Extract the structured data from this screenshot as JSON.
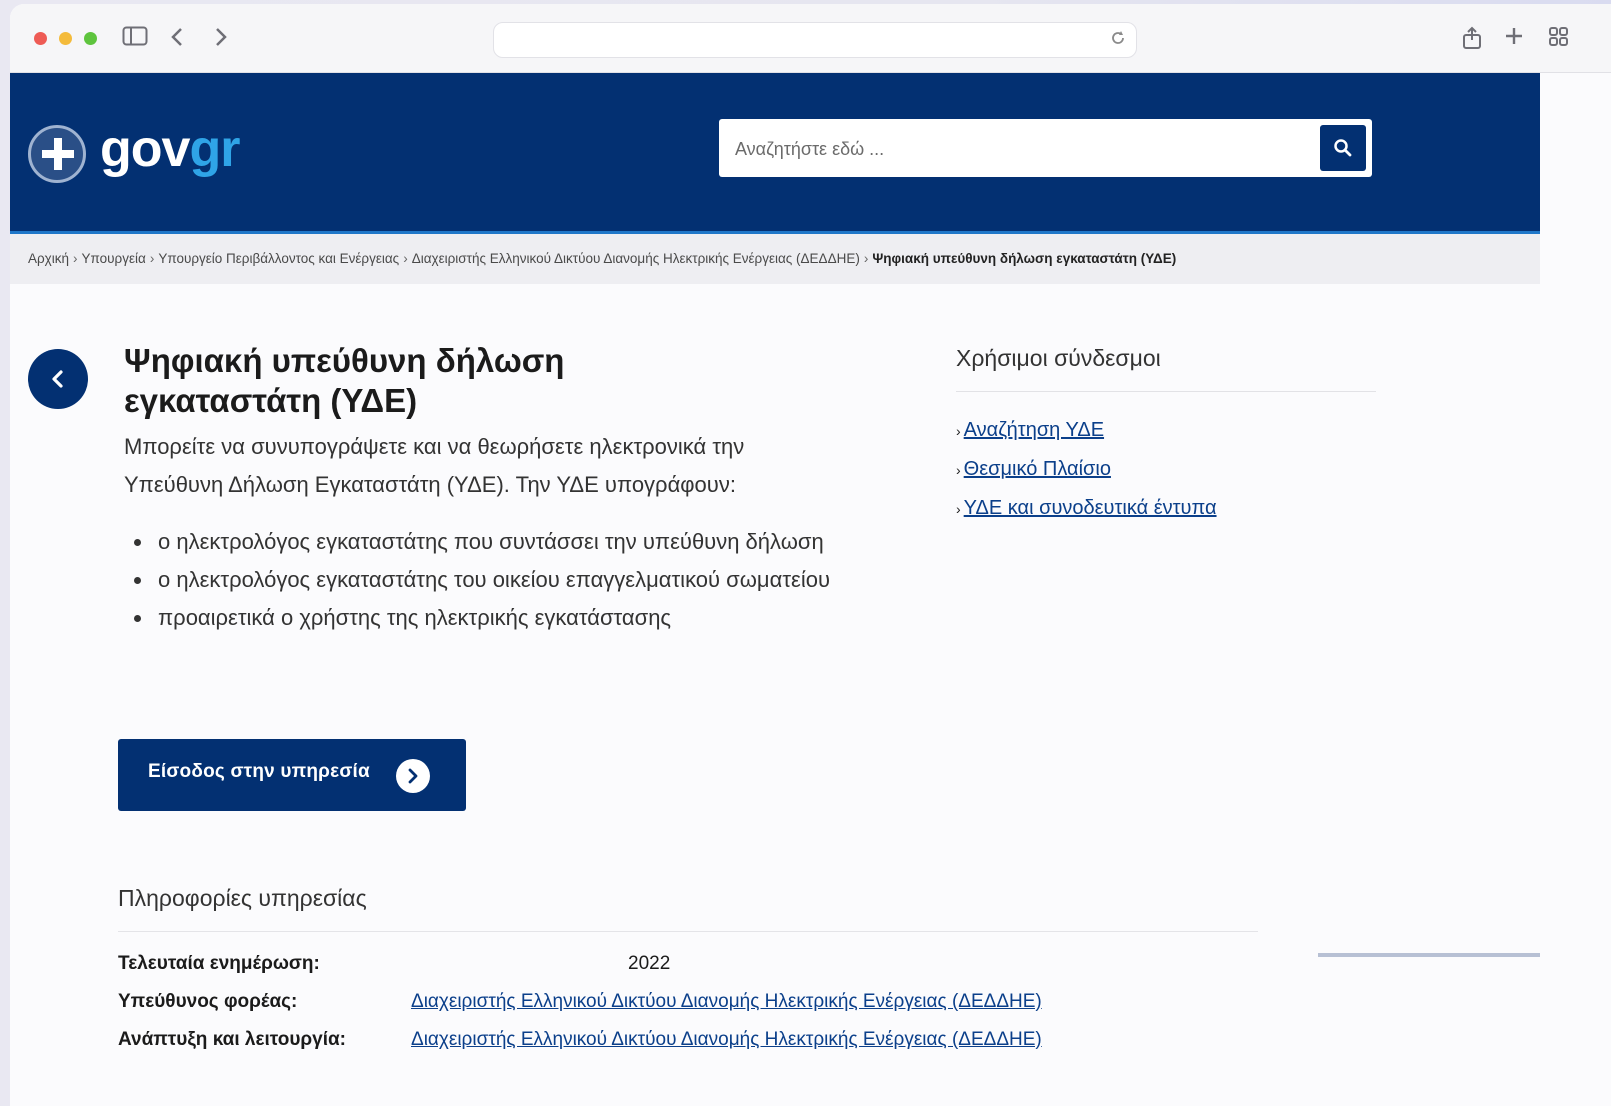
{
  "browser": {
    "url": ""
  },
  "header": {
    "logo_gov": "gov",
    "logo_gr": "gr",
    "search_placeholder": "Αναζητήστε εδώ ..."
  },
  "breadcrumb": [
    "Αρχική",
    "Υπουργεία",
    "Υπουργείο Περιβάλλοντος και Ενέργειας",
    "Διαχειριστής Ελληνικού Δικτύου Διανομής Ηλεκτρικής Ενέργειας (ΔΕΔΔΗΕ)",
    "Ψηφιακή υπεύθυνη δήλωση εγκαταστάτη (ΥΔΕ)"
  ],
  "main": {
    "title": "Ψηφιακή υπεύθυνη δήλωση εγκαταστάτη (ΥΔΕ)",
    "intro": "Μπορείτε να συνυπογράψετε και να θεωρήσετε ηλεκτρονικά την Υπεύθυνη Δήλωση Εγκαταστάτη (ΥΔΕ). Την ΥΔΕ υπογράφουν:",
    "bullets": [
      "ο ηλεκτρολόγος εγκαταστάτης που συντάσσει την υπεύθυνη δήλωση",
      "ο ηλεκτρολόγος εγκαταστάτης του οικείου επαγγελματικού σωματείου",
      "προαιρετικά ο χρήστης της ηλεκτρικής εγκατάστασης"
    ],
    "service_button": "Είσοδος στην υπηρεσία"
  },
  "useful_links": {
    "title": "Χρήσιμοι σύνδεσμοι",
    "items": [
      "Αναζήτηση ΥΔΕ",
      "Θεσμικό Πλαίσιο",
      "ΥΔΕ και συνοδευτικά έντυπα"
    ]
  },
  "info": {
    "title": "Πληροφορίες υπηρεσίας",
    "last_update_label": "Τελευταία ενημέρωση:",
    "last_update_value": "2022",
    "responsible_label": "Υπεύθυνος φορέας:",
    "responsible_value": "Διαχειριστής Ελληνικού Δικτύου Διανομής Ηλεκτρικής Ενέργειας (ΔΕΔΔΗΕ)",
    "dev_label": "Ανάπτυξη και λειτουργία:",
    "dev_value": "Διαχειριστής Ελληνικού Δικτύου Διανομής Ηλεκτρικής Ενέργειας (ΔΕΔΔΗΕ)"
  },
  "colors": {
    "brand_blue": "#033072",
    "accent_light_blue": "#2fa4e7",
    "link": "#0b3f8a"
  }
}
